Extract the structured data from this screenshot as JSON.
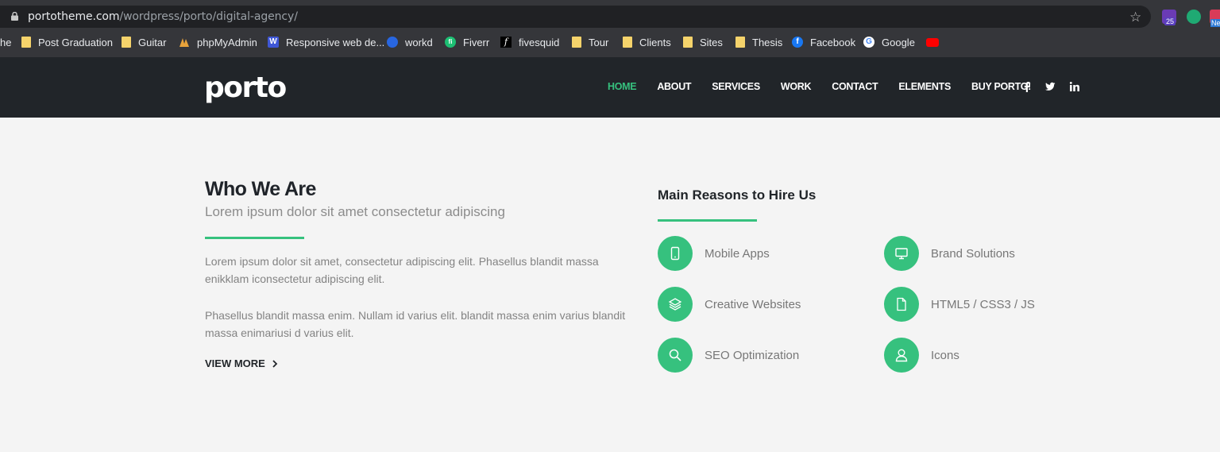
{
  "browser": {
    "url_host": "portotheme.com",
    "url_path": "/wordpress/porto/digital-agency/",
    "extension_badge_1": "25",
    "extension_badge_3": "Ne",
    "bookmarks": [
      {
        "label": "Post Graduation",
        "icon": "folder-icon"
      },
      {
        "label": "Guitar",
        "icon": "folder-icon"
      },
      {
        "label": "phpMyAdmin",
        "icon": "phpmyadmin-icon"
      },
      {
        "label": "Responsive web de...",
        "icon": "w-icon"
      },
      {
        "label": "workd",
        "icon": "workd-icon"
      },
      {
        "label": "Fiverr",
        "icon": "fiverr-icon"
      },
      {
        "label": "fivesquid",
        "icon": "fivesquid-icon"
      },
      {
        "label": "Tour",
        "icon": "folder-icon"
      },
      {
        "label": "Clients",
        "icon": "folder-icon"
      },
      {
        "label": "Sites",
        "icon": "folder-icon"
      },
      {
        "label": "Thesis",
        "icon": "folder-icon"
      },
      {
        "label": "Facebook",
        "icon": "facebook-icon"
      },
      {
        "label": "Google",
        "icon": "google-icon"
      }
    ],
    "cut_bookmark": "he"
  },
  "site": {
    "logo": "porto",
    "nav": [
      "HOME",
      "ABOUT",
      "SERVICES",
      "WORK",
      "CONTACT",
      "ELEMENTS",
      "BUY PORTO!"
    ],
    "social": [
      "facebook-icon",
      "twitter-icon",
      "linkedin-icon"
    ]
  },
  "who": {
    "title": "Who We Are",
    "subtitle": "Lorem ipsum dolor sit amet consectetur adipiscing",
    "p1": "Lorem ipsum dolor sit amet, consectetur adipiscing elit. Phasellus blandit massa enikklam iconsectetur adipiscing elit.",
    "p2": "Phasellus blandit massa enim. Nullam id varius elit. blandit massa enim varius blandit massa enimariusi d varius elit.",
    "view_more": "VIEW MORE"
  },
  "reasons": {
    "title": "Main Reasons to Hire Us",
    "items": [
      {
        "label": "Mobile Apps",
        "icon": "mobile-icon"
      },
      {
        "label": "Brand Solutions",
        "icon": "monitor-icon"
      },
      {
        "label": "Creative Websites",
        "icon": "layers-icon"
      },
      {
        "label": "HTML5 / CSS3 / JS",
        "icon": "document-icon"
      },
      {
        "label": "SEO Optimization",
        "icon": "search-icon"
      },
      {
        "label": "Icons",
        "icon": "user-icon"
      }
    ]
  },
  "colors": {
    "accent": "#36c17e",
    "header_bg": "#212529",
    "page_bg": "#f4f4f4"
  }
}
